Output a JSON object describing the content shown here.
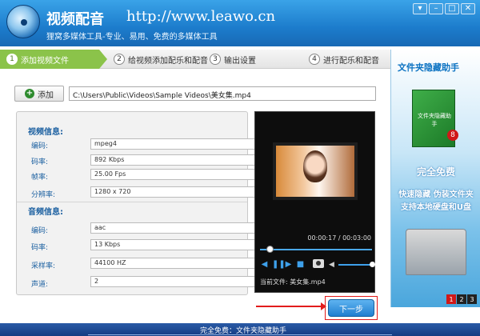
{
  "header": {
    "title": "视频配音",
    "url": "http://www.leawo.cn",
    "subtitle": "狸窝多媒体工具-专业、易用、免费的多媒体工具",
    "window_buttons": [
      "▾",
      "–",
      "□",
      "✕"
    ]
  },
  "steps": [
    {
      "num": "1",
      "label": "添加视频文件",
      "active": true
    },
    {
      "num": "2",
      "label": "给视频添加配乐和配音",
      "active": false
    },
    {
      "num": "3",
      "label": "输出设置",
      "active": false
    },
    {
      "num": "4",
      "label": "进行配乐和配音",
      "active": false
    }
  ],
  "toolbar": {
    "add_label": "添加",
    "file_path": "C:\\Users\\Public\\Videos\\Sample Videos\\美女集.mp4"
  },
  "video_info": {
    "title": "视频信息:",
    "rows": [
      {
        "label": "编码:",
        "value": "mpeg4"
      },
      {
        "label": "码率:",
        "value": "892 Kbps"
      },
      {
        "label": "帧率:",
        "value": "25.00 Fps"
      },
      {
        "label": "分辨率:",
        "value": "1280 x 720"
      }
    ]
  },
  "audio_info": {
    "title": "音频信息:",
    "rows": [
      {
        "label": "编码:",
        "value": "aac"
      },
      {
        "label": "码率:",
        "value": "13 Kbps"
      },
      {
        "label": "采样率:",
        "value": "44100 HZ"
      },
      {
        "label": "声道:",
        "value": "2"
      }
    ]
  },
  "player": {
    "timecode": "00:00:17 / 00:03:00",
    "current_file": "当前文件: 美女集.mp4"
  },
  "next_label": "下一步",
  "ad": {
    "title": "文件夹隐藏助手",
    "box_label": "文件夹隐藏助手",
    "badge": "8",
    "free": "完全免费",
    "line1": "快速隐藏 伪装文件夹",
    "line2": "支持本地硬盘和U盘",
    "pages": [
      "1",
      "2",
      "3"
    ]
  },
  "footer": {
    "text": "完全免费：文件夹隐藏助手"
  }
}
